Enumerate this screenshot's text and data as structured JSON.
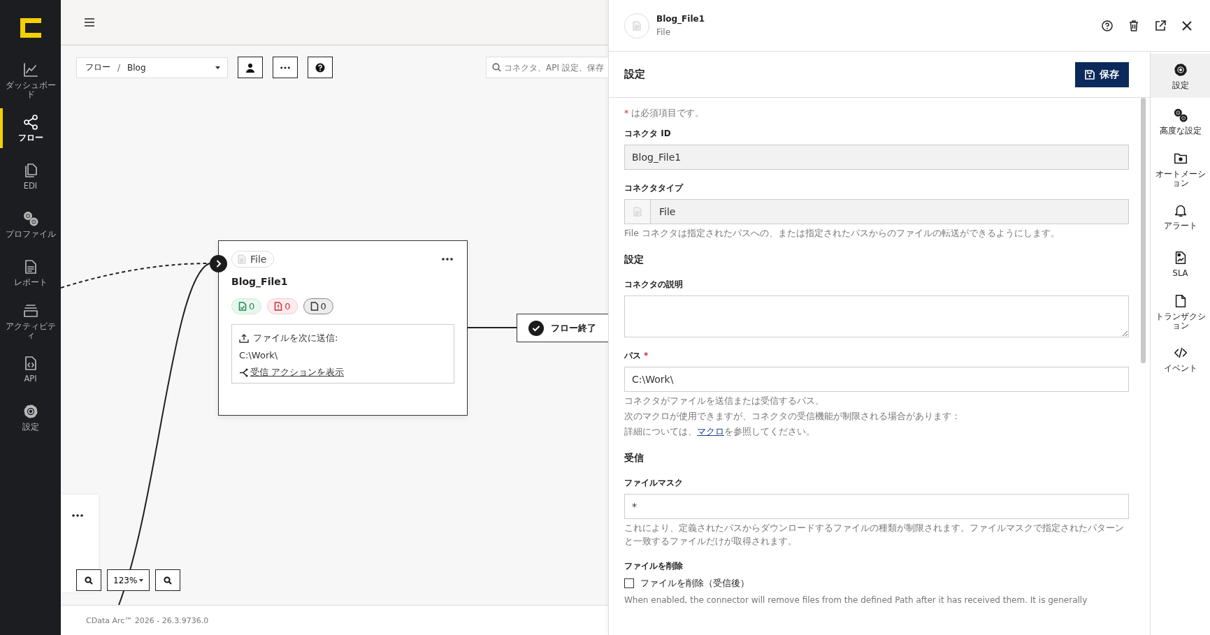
{
  "sidebar": {
    "items": [
      {
        "label": "ダッシュボード",
        "selected": false
      },
      {
        "label": "フロー",
        "selected": true
      },
      {
        "label": "EDI",
        "selected": false
      },
      {
        "label": "プロファイル",
        "selected": false
      },
      {
        "label": "レポート",
        "selected": false
      },
      {
        "label": "アクティビティ",
        "selected": false
      },
      {
        "label": "API",
        "selected": false
      },
      {
        "label": "設定",
        "selected": false
      }
    ]
  },
  "toolbar": {
    "breadcrumb": [
      "フロー",
      "Blog"
    ],
    "separator": "/",
    "search": {
      "placeholder": "コネクタ、API 設定、保存"
    }
  },
  "canvas": {
    "node": {
      "type_label": "File",
      "title": "Blog_File1",
      "counts": [
        {
          "kind": "success",
          "value": "0"
        },
        {
          "kind": "error",
          "value": "0"
        },
        {
          "kind": "pending",
          "value": "0"
        }
      ],
      "action_label": "ファイルを次に送信:",
      "action_path": "C:\\Work\\",
      "link": "受信 アクションを表示"
    },
    "end_node": {
      "label": "フロー終了"
    },
    "zoom": "123%"
  },
  "footer": "CData Arc™ 2026 - 26.3.9736.0",
  "panel": {
    "title": "Blog_File1",
    "subtitle": "File",
    "section_title": "設定",
    "save_label": "保存",
    "form": [
      {
        "kind": "note",
        "mark": "*",
        "text": "は必須項目です。"
      },
      {
        "kind": "input",
        "label": "コネクタ ID",
        "value": "Blog_File1",
        "readonly": true
      },
      {
        "kind": "type",
        "label": "コネクタタイプ",
        "value": "File",
        "readonly": true,
        "help": [
          "File コネクタは指定されたパスへの、または指定されたパスからのファイルの転送ができるようにします。"
        ]
      },
      {
        "kind": "heading",
        "text": "設定"
      },
      {
        "kind": "textarea",
        "label": "コネクタの説明"
      },
      {
        "kind": "input",
        "label": "パス",
        "required_mark": "*",
        "value": "C:\\Work\\",
        "readonly": false,
        "help": [
          "コネクタがファイルを送信または受信するパス。",
          "次のマクロが使用できますが、コネクタの受信機能が制限される場合があります：",
          {
            "before": "詳細については、",
            "link": "マクロ",
            "after": "を参照してください。"
          }
        ]
      },
      {
        "kind": "heading",
        "text": "受信"
      },
      {
        "kind": "input",
        "label": "ファイルマスク",
        "value": "*",
        "readonly": false,
        "help": [
          "これにより、定義されたパスからダウンロードするファイルの種類が制限されます。ファイルマスクで指定されたパターンと一致するファイルだけが取得されます。"
        ]
      },
      {
        "kind": "checkbox",
        "label": "ファイルを削除",
        "option": "ファイルを削除（受信後）",
        "checked": false,
        "help": [
          "When enabled, the connector will remove files from the defined Path after it has received them. It is generally"
        ]
      }
    ],
    "nav": [
      {
        "label": "設定",
        "selected": true
      },
      {
        "label": "高度な設定",
        "selected": false
      },
      {
        "label": "オートメーション",
        "selected": false
      },
      {
        "label": "アラート",
        "selected": false
      },
      {
        "label": "SLA",
        "selected": false
      },
      {
        "label": "トランザクション",
        "selected": false
      },
      {
        "label": "イベント",
        "selected": false
      }
    ]
  }
}
